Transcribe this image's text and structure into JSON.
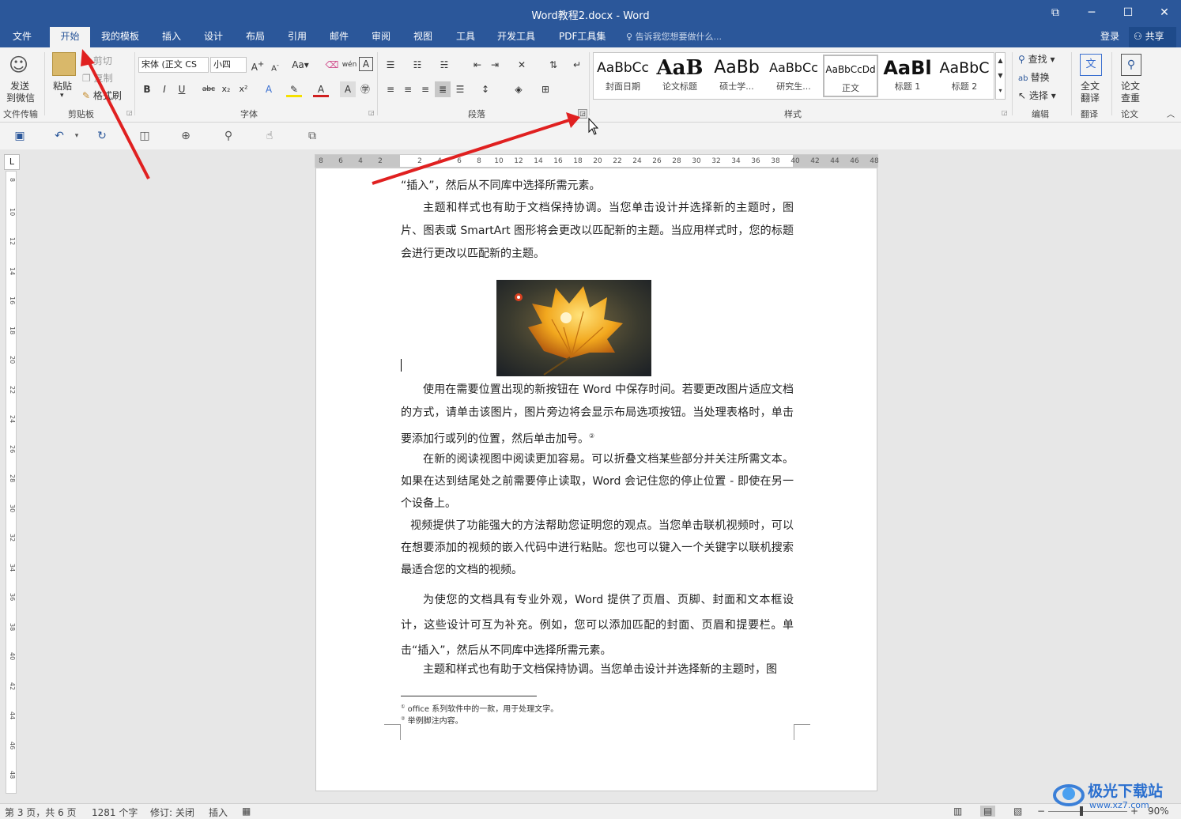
{
  "window": {
    "title": "Word教程2.docx - Word"
  },
  "tabs": [
    "文件",
    "开始",
    "我的模板",
    "插入",
    "设计",
    "布局",
    "引用",
    "邮件",
    "审阅",
    "视图",
    "工具",
    "开发工具",
    "PDF工具集"
  ],
  "tell_me": "告诉我您想要做什么...",
  "account": {
    "login": "登录",
    "share": "共享"
  },
  "ribbon": {
    "wechat": {
      "line1": "发送",
      "line2": "到微信",
      "group": "文件传输"
    },
    "clipboard": {
      "paste": "粘贴",
      "cut": "剪切",
      "copy": "复制",
      "painter": "格式刷",
      "group": "剪贴板"
    },
    "font": {
      "name": "宋体 (正文 CS",
      "size": "小四",
      "group": "字体"
    },
    "paragraph": {
      "group": "段落"
    },
    "styles": {
      "group": "样式",
      "items": [
        {
          "preview": "AaBbCc",
          "name": "封面日期"
        },
        {
          "preview": "AaB",
          "name": "论文标题"
        },
        {
          "preview": "AaBb",
          "name": "硕士学..."
        },
        {
          "preview": "AaBbCc",
          "name": "研究生..."
        },
        {
          "preview": "AaBbCcDd",
          "name": "正文"
        },
        {
          "preview": "AaBl",
          "name": "标题 1"
        },
        {
          "preview": "AaBbC",
          "name": "标题 2"
        }
      ]
    },
    "editing": {
      "find": "查找",
      "replace": "替换",
      "select": "选择",
      "group": "编辑"
    },
    "translate": {
      "line1": "全文",
      "line2": "翻译",
      "group": "翻译"
    },
    "paper": {
      "line1": "论文",
      "line2": "查重",
      "group": "论文"
    }
  },
  "ruler_h": [
    "8",
    "6",
    "4",
    "2",
    "",
    "2",
    "4",
    "6",
    "8",
    "10",
    "12",
    "14",
    "16",
    "18",
    "20",
    "22",
    "24",
    "26",
    "28",
    "30",
    "32",
    "34",
    "36",
    "38",
    "40",
    "42",
    "44",
    "46",
    "48"
  ],
  "ruler_v": [
    "8",
    "10",
    "12",
    "14",
    "16",
    "18",
    "20",
    "22",
    "24",
    "26",
    "28",
    "30",
    "32",
    "34",
    "36",
    "38",
    "40",
    "42",
    "44",
    "46",
    "48"
  ],
  "doc": {
    "paragraphs": [
      "“插入”，然后从不同库中选择所需元素。",
      "主题和样式也有助于文档保持协调。当您单击设计并选择新的主题时，图片、图表或 SmartArt 图形将会更改以匹配新的主题。当应用样式时，您的标题会进行更改以匹配新的主题。",
      "使用在需要位置出现的新按钮在 Word 中保存时间。若要更改图片适应文档的方式，请单击该图片，图片旁边将会显示布局选项按钮。当处理表格时，单击要添加行或列的位置，然后单击加号。",
      "在新的阅读视图中阅读更加容易。可以折叠文档某些部分并关注所需文本。如果在达到结尾处之前需要停止读取，Word 会记住您的停止位置 - 即使在另一个设备上。",
      "视频提供了功能强大的方法帮助您证明您的观点。当您单击联机视频时，可以在想要添加的视频的嵌入代码中进行粘贴。您也可以键入一个关键字以联机搜索最适合您的文档的视频。",
      "为使您的文档具有专业外观，Word 提供了页眉、页脚、封面和文本框设计，这些设计可互为补充。例如，您可以添加匹配的封面、页眉和提要栏。单击“插入”，然后从不同库中选择所需元素。",
      "主题和样式也有助于文档保持协调。当您单击设计并选择新的主题时，图"
    ],
    "footnote_mark": "②",
    "footnotes": [
      "office 系列软件中的一款，用于处理文字。",
      "举例脚注内容。"
    ],
    "footnote_marks": [
      "①",
      "②"
    ]
  },
  "status": {
    "page": "第 3 页，共 6 页",
    "words": "1281 个字",
    "track": "修订: 关闭",
    "mode": "插入",
    "zoom": "90%"
  },
  "watermark": {
    "name": "极光下载站",
    "url": "www.xz7.com"
  },
  "colors": {
    "brand": "#2b579a",
    "arrow": "#e02020"
  }
}
